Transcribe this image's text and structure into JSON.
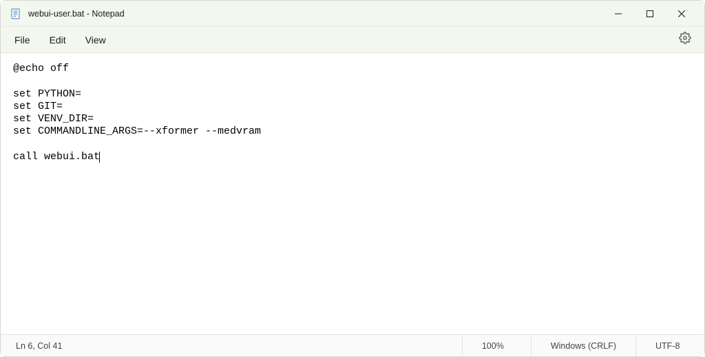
{
  "window": {
    "title": "webui-user.bat - Notepad"
  },
  "menu": {
    "file": "File",
    "edit": "Edit",
    "view": "View"
  },
  "editor": {
    "content": "@echo off\n\nset PYTHON=\nset GIT=\nset VENV_DIR=\nset COMMANDLINE_ARGS=--xformer --medvram\n\ncall webui.bat"
  },
  "status": {
    "position": "Ln 6, Col 41",
    "zoom": "100%",
    "line_ending": "Windows (CRLF)",
    "encoding": "UTF-8"
  }
}
